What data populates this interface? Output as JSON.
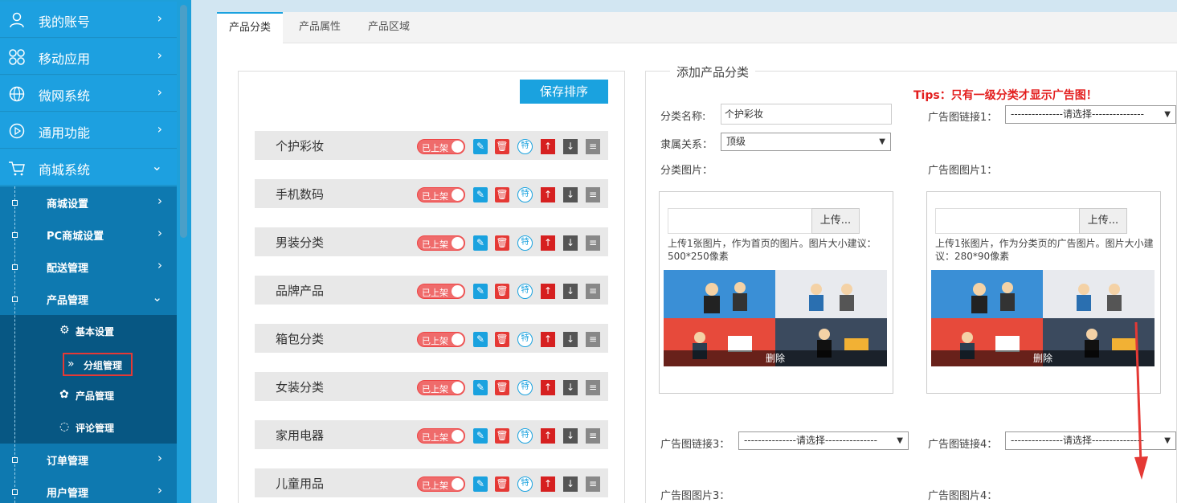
{
  "sidebar": {
    "top_items": [
      {
        "label": "我的账号",
        "icon": "user-icon"
      },
      {
        "label": "移动应用",
        "icon": "apps-icon"
      },
      {
        "label": "微网系统",
        "icon": "globe-icon"
      },
      {
        "label": "通用功能",
        "icon": "play-icon"
      },
      {
        "label": "商城系统",
        "icon": "cart-icon"
      }
    ],
    "sub_items": [
      {
        "label": "商城设置"
      },
      {
        "label": "PC商城设置"
      },
      {
        "label": "配送管理"
      },
      {
        "label": "产品管理"
      },
      {
        "label": "订单管理"
      },
      {
        "label": "用户管理"
      }
    ],
    "product_children": [
      {
        "label": "基本设置",
        "icon": "gear-icon"
      },
      {
        "label": "分组管理",
        "icon": "double-chevron-icon",
        "active": true
      },
      {
        "label": "产品管理",
        "icon": "puzzle-icon"
      },
      {
        "label": "评论管理",
        "icon": "comment-icon"
      }
    ]
  },
  "tabs": [
    {
      "label": "产品分类",
      "active": true
    },
    {
      "label": "产品属性"
    },
    {
      "label": "产品区域"
    }
  ],
  "list": {
    "save_label": "保存排序",
    "toggle_label": "已上架",
    "special_label": "特",
    "categories": [
      "个护彩妆",
      "手机数码",
      "男装分类",
      "品牌产品",
      "箱包分类",
      "女装分类",
      "家用电器",
      "儿童用品"
    ]
  },
  "form": {
    "legend": "添加产品分类",
    "tips": "Tips：只有一级分类才显示广告图！",
    "name_label": "分类名称:",
    "name_value": "个护彩妆",
    "relation_label": "隶属关系：",
    "relation_value": "顶级",
    "cat_image_label": "分类图片：",
    "ad_link1_label": "广告图链接1：",
    "ad_image1_label": "广告图图片1：",
    "ad_link3_label": "广告图链接3：",
    "ad_link4_label": "广告图链接4：",
    "ad_image3_label": "广告图图片3：",
    "ad_image4_label": "广告图图片4：",
    "select_placeholder": "---------------请选择---------------",
    "upload_label": "上传...",
    "delete_label": "删除",
    "cat_hint": "上传1张图片，作为首页的图片。图片大小建议：500*250像素",
    "ad_hint": "上传1张图片，作为分类页的广告图片。图片大小建议：280*90像素"
  },
  "colors": {
    "accent": "#1aa2df",
    "danger": "#e53935",
    "sidebar": "#1da0e0",
    "sidebar_sub": "#0e79b0",
    "sidebar_sub2": "#075783"
  }
}
